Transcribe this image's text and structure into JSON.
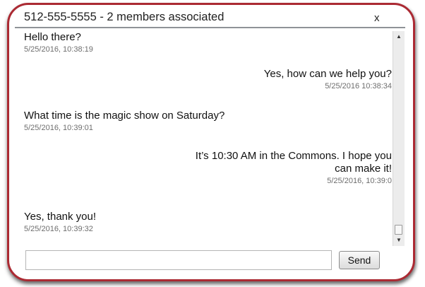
{
  "chat": {
    "title": "512-555-5555 - 2 members associated",
    "close_label": "x",
    "messages": [
      {
        "side": "left",
        "text": "Hello there?",
        "time": "5/25/2016, 10:38:19"
      },
      {
        "side": "right",
        "text": "Yes, how can we help you?",
        "time": "5/25/2016 10:38:34"
      },
      {
        "side": "left",
        "text": "What time is the magic show on Saturday?",
        "time": "5/25/2016, 10:39:01"
      },
      {
        "side": "right",
        "text_line1": "It’s 10:30 AM in the Commons.  I hope you",
        "text_line2": "can make it!",
        "time": "5/25/2016, 10:39:0"
      },
      {
        "side": "left",
        "text": "Yes, thank you!",
        "time": "5/25/2016, 10:39:32"
      }
    ],
    "input": {
      "value": "",
      "placeholder": ""
    },
    "send_label": "Send"
  },
  "colors": {
    "frame_border": "#ab2a33",
    "timestamp": "#6e6e6e",
    "title_rule": "#8f9397"
  },
  "icons": {
    "scroll_up": "scroll-up-arrow-icon",
    "scroll_down": "scroll-down-arrow-icon",
    "close": "close-icon"
  }
}
